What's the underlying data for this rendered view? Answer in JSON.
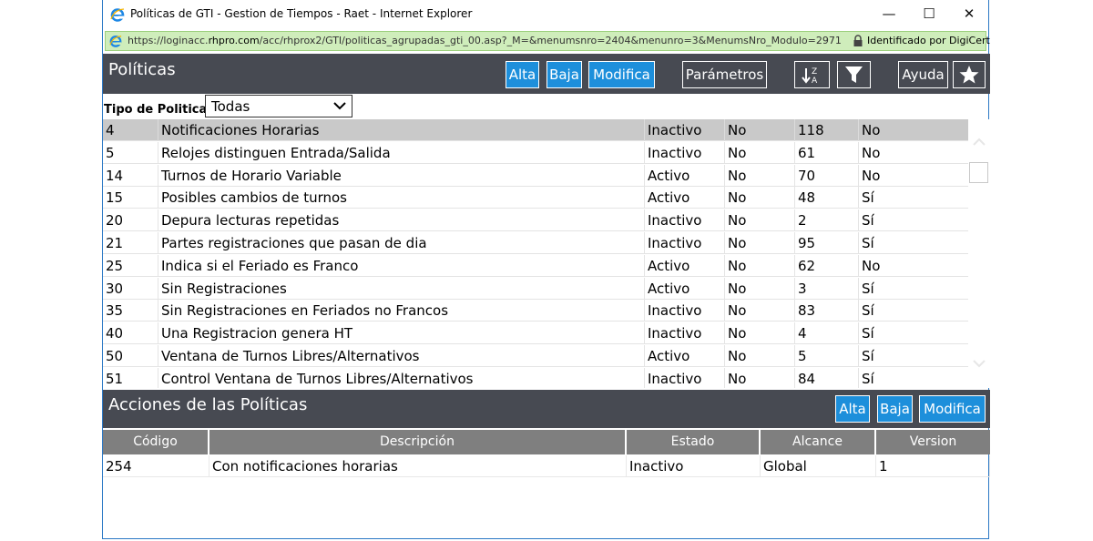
{
  "window": {
    "title": "Políticas de GTI - Gestion de Tiempos - Raet - Internet Explorer",
    "url_prefix": "https://loginacc.",
    "url_domain": "rhpro.com",
    "url_rest": "/acc/rhprox2/GTI/politicas_agrupadas_gti_00.asp?_M=&menumsnro=2404&menunro=3&MenumsNro_Modulo=2971",
    "cert_text": "Identificado por DigiCert",
    "minimize": "—",
    "maximize": "☐",
    "close": "✕"
  },
  "policies": {
    "title": "Políticas",
    "buttons": {
      "alta": "Alta",
      "baja": "Baja",
      "modifica": "Modifica",
      "parametros": "Parámetros",
      "ayuda": "Ayuda"
    },
    "filter_label": "Tipo de Politica:",
    "filter_value": "Todas",
    "rows": [
      {
        "id": "4",
        "name": "Notificaciones Horarias",
        "estado": "Inactivo",
        "flag": "No",
        "num": "118",
        "opt": "No"
      },
      {
        "id": "5",
        "name": "Relojes distinguen Entrada/Salida",
        "estado": "Inactivo",
        "flag": "No",
        "num": "61",
        "opt": "No"
      },
      {
        "id": "14",
        "name": "Turnos de Horario Variable",
        "estado": "Activo",
        "flag": "No",
        "num": "70",
        "opt": "No"
      },
      {
        "id": "15",
        "name": "Posibles cambios de turnos",
        "estado": "Activo",
        "flag": "No",
        "num": "48",
        "opt": "Sí"
      },
      {
        "id": "20",
        "name": "Depura lecturas repetidas",
        "estado": "Inactivo",
        "flag": "No",
        "num": "2",
        "opt": "Sí"
      },
      {
        "id": "21",
        "name": "Partes registraciones que pasan de dia",
        "estado": "Inactivo",
        "flag": "No",
        "num": "95",
        "opt": "Sí"
      },
      {
        "id": "25",
        "name": "Indica si el Feriado es Franco",
        "estado": "Activo",
        "flag": "No",
        "num": "62",
        "opt": "No"
      },
      {
        "id": "30",
        "name": "Sin Registraciones",
        "estado": "Activo",
        "flag": "No",
        "num": "3",
        "opt": "Sí"
      },
      {
        "id": "35",
        "name": "Sin Registraciones en Feriados no Francos",
        "estado": "Inactivo",
        "flag": "No",
        "num": "83",
        "opt": "Sí"
      },
      {
        "id": "40",
        "name": "Una Registracion genera HT",
        "estado": "Inactivo",
        "flag": "No",
        "num": "4",
        "opt": "Sí"
      },
      {
        "id": "50",
        "name": "Ventana de Turnos Libres/Alternativos",
        "estado": "Activo",
        "flag": "No",
        "num": "5",
        "opt": "Sí"
      },
      {
        "id": "51",
        "name": "Control Ventana de Turnos Libres/Alternativos",
        "estado": "Inactivo",
        "flag": "No",
        "num": "84",
        "opt": "Sí"
      }
    ],
    "selected_index": 0
  },
  "actions": {
    "title": "Acciones de las Políticas",
    "buttons": {
      "alta": "Alta",
      "baja": "Baja",
      "modifica": "Modifica"
    },
    "columns": [
      "Código",
      "Descripción",
      "Estado",
      "Alcance",
      "Version"
    ],
    "rows": [
      {
        "codigo": "254",
        "descripcion": "Con notificaciones horarias",
        "estado": "Inactivo",
        "alcance": "Global",
        "version": "1"
      }
    ]
  },
  "colors": {
    "accent": "#1d8fdb",
    "header": "#474a52",
    "selected_row": "#c9c9c9"
  }
}
